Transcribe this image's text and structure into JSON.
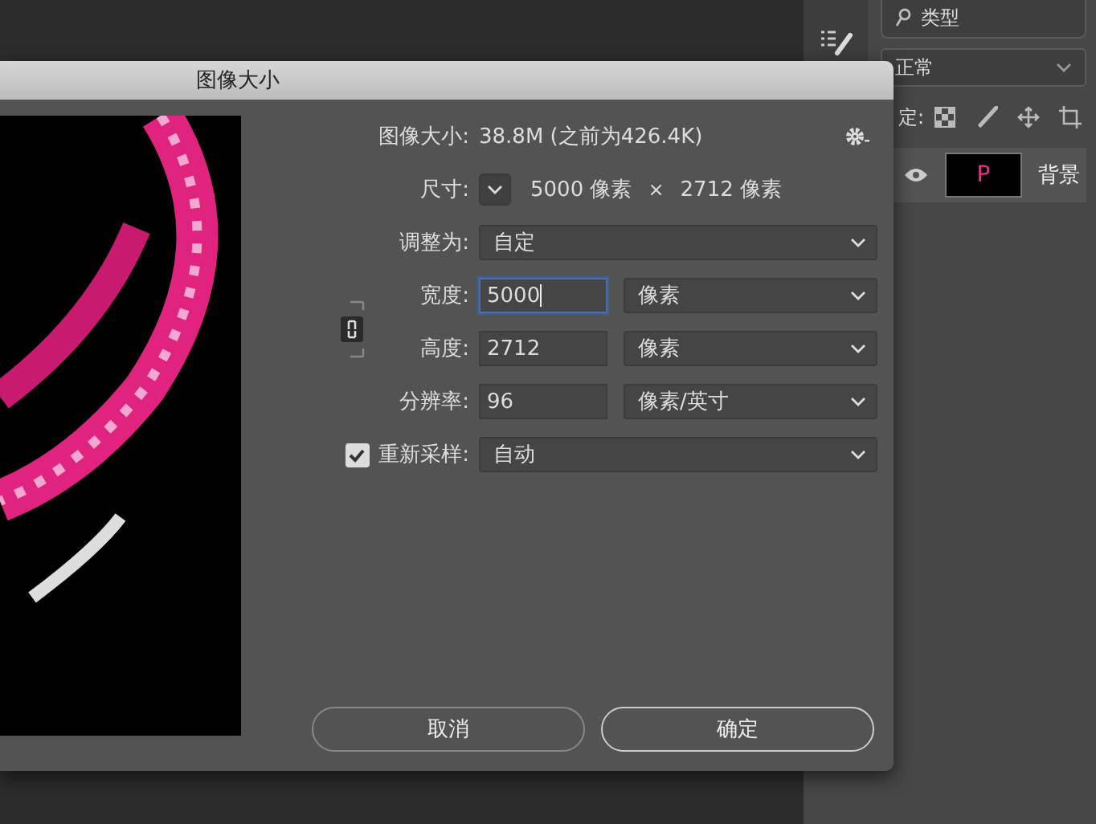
{
  "layers_panel": {
    "filter": "类型",
    "blend_mode": "正常",
    "lock_label": "定:",
    "layers": [
      {
        "name": "背景",
        "thumbnail_text": "P",
        "visible": true
      }
    ]
  },
  "dialog": {
    "title": "图像大小",
    "image_size": {
      "label": "图像大小:",
      "value": "38.8M (之前为426.4K)"
    },
    "dimensions": {
      "label": "尺寸:",
      "width": "5000 像素",
      "times": "×",
      "height": "2712 像素"
    },
    "fit_to": {
      "label": "调整为:",
      "value": "自定"
    },
    "constrain_proportions": {
      "linked": true
    },
    "fields": [
      {
        "label": "宽度:",
        "value": "5000",
        "unit": "像素",
        "focused": true
      },
      {
        "label": "高度:",
        "value": "2712",
        "unit": "像素",
        "focused": false
      },
      {
        "label": "分辨率:",
        "value": "96",
        "unit": "像素/英寸",
        "focused": false
      }
    ],
    "resample": {
      "label": "重新采样:",
      "checked": true,
      "value": "自动"
    },
    "buttons": [
      {
        "label": "取消",
        "kind": "cancel"
      },
      {
        "label": "确定",
        "kind": "ok"
      }
    ]
  }
}
